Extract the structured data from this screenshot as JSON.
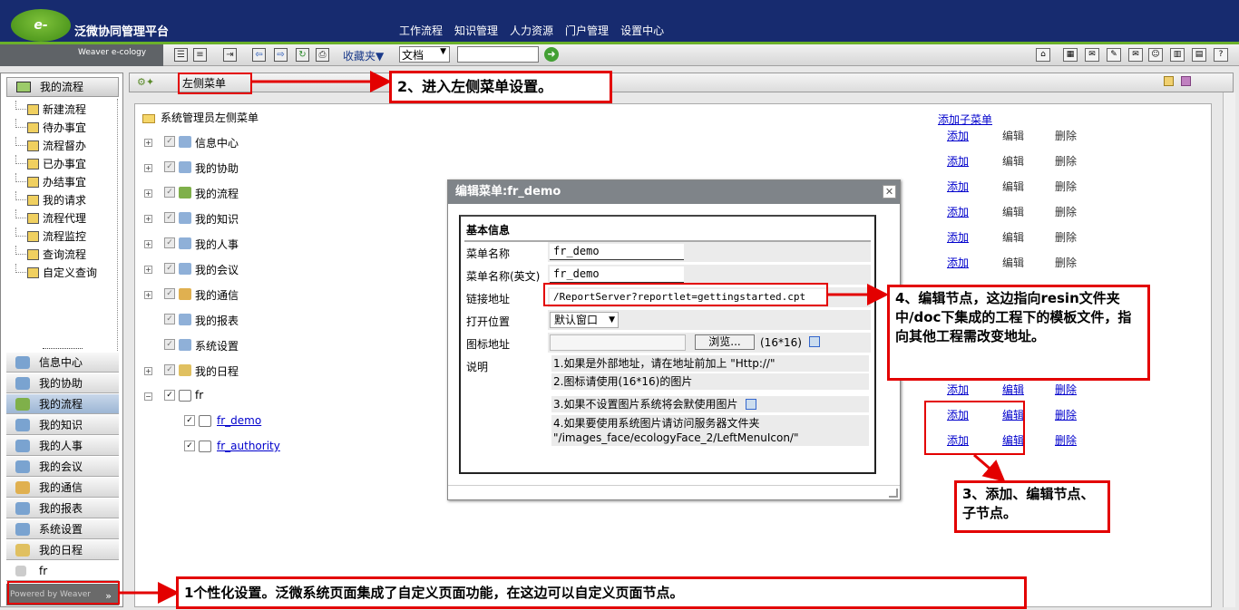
{
  "brand": {
    "logo_text": "e-cology",
    "title": "泛微协同管理平台",
    "subtitle": "Weaver e-cology"
  },
  "topnav": [
    "工作流程",
    "知识管理",
    "人力资源",
    "门户管理",
    "设置中心"
  ],
  "toolbar": {
    "favorites": "收藏夹▼",
    "doc_select": "文档",
    "search_value": ""
  },
  "sidebar": {
    "header": "我的流程",
    "tree": [
      "新建流程",
      "待办事宜",
      "流程督办",
      "已办事宜",
      "办结事宜",
      "我的请求",
      "流程代理",
      "流程监控",
      "查询流程",
      "自定义查询"
    ],
    "modules": [
      "信息中心",
      "我的协助",
      "我的流程",
      "我的知识",
      "我的人事",
      "我的会议",
      "我的通信",
      "我的报表",
      "系统设置",
      "我的日程",
      "fr"
    ],
    "active_module": "我的流程",
    "footer": "Powered by Weaver"
  },
  "breadcrumb": "左侧菜单",
  "main": {
    "root": "系统管理员左侧菜单",
    "add_sub": "添加子菜单",
    "actions": {
      "add": "添加",
      "edit": "编辑",
      "delete": "删除"
    },
    "items": [
      "信息中心",
      "我的协助",
      "我的流程",
      "我的知识",
      "我的人事",
      "我的会议",
      "我的通信",
      "我的报表",
      "系统设置",
      "我的日程",
      "fr",
      "fr_demo",
      "fr_authority"
    ]
  },
  "dialog": {
    "title": "编辑菜单:fr_demo",
    "section": "基本信息",
    "fields": {
      "menu_name_label": "菜单名称",
      "menu_name": "fr_demo",
      "menu_name_en_label": "菜单名称(英文)",
      "menu_name_en": "fr_demo",
      "link_label": "链接地址",
      "link": "/ReportServer?reportlet=gettingstarted.cpt",
      "open_label": "打开位置",
      "open": "默认窗口",
      "icon_label": "图标地址",
      "browse": "浏览...",
      "icon_size": "(16*16)",
      "desc_label": "说明"
    },
    "notes": [
      "1.如果是外部地址，请在地址前加上 \"Http://\"",
      "2.图标请使用(16*16)的图片",
      "3.如果不设置图片系统将会默使用图片",
      "4.如果要使用系统图片请访问服务器文件夹",
      "\"/images_face/ecologyFace_2/LeftMenuIcon/\""
    ]
  },
  "callouts": {
    "c1": "1个性化设置。泛微系统页面集成了自定义页面功能，在这边可以自定义页面节点。",
    "c2": "2、进入左侧菜单设置。",
    "c3": "3、添加、编辑节点、子节点。",
    "c4": "4、编辑节点，这边指向resin文件夹中/doc下集成的工程下的模板文件，指向其他工程需改变地址。"
  }
}
